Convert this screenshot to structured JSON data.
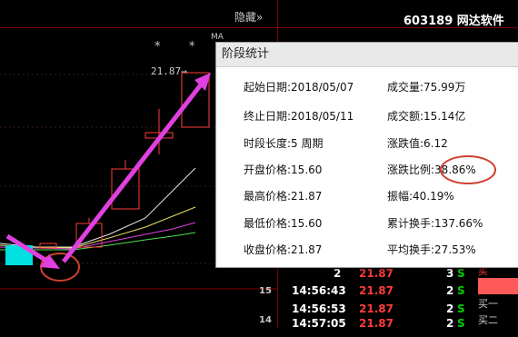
{
  "header": {
    "hide_label": "隐藏»",
    "stock_code_name": "603189 网达软件"
  },
  "chart": {
    "ma_label": "MA",
    "stars": [
      "*",
      "*"
    ],
    "price_marker": "21.87→"
  },
  "dialog": {
    "title": "阶段统计",
    "left": [
      {
        "label": "起始日期:",
        "value": "2018/05/07"
      },
      {
        "label": "终止日期:",
        "value": "2018/05/11"
      },
      {
        "label": "时段长度:",
        "value": "5 周期"
      },
      {
        "label": "开盘价格:",
        "value": "15.60"
      },
      {
        "label": "最高价格:",
        "value": "21.87"
      },
      {
        "label": "最低价格:",
        "value": "15.60"
      },
      {
        "label": "收盘价格:",
        "value": "21.87"
      }
    ],
    "right": [
      {
        "label": "成交量:",
        "value": "75.99万"
      },
      {
        "label": "成交额:",
        "value": "15.14亿"
      },
      {
        "label": "涨跌值:",
        "value": "6.12"
      },
      {
        "label": "涨跌比例:",
        "value": "38.86%"
      },
      {
        "label": "振幅:",
        "value": "40.19%"
      },
      {
        "label": "累计换手:",
        "value": "137.66%"
      },
      {
        "label": "平均换手:",
        "value": "27.53%"
      }
    ]
  },
  "ticks": [
    {
      "time": "2",
      "price": "21.87",
      "vol": "3",
      "side": "S"
    },
    {
      "time": "14:56:43",
      "price": "21.87",
      "vol": "2",
      "side": "S"
    },
    {
      "time": "14:56:53",
      "price": "21.87",
      "vol": "2",
      "side": "S"
    },
    {
      "time": "14:57:05",
      "price": "21.87",
      "vol": "2",
      "side": "S"
    }
  ],
  "row_numbers": [
    "15",
    "14"
  ],
  "side_labels": [
    "买",
    "买一",
    "买二"
  ],
  "colors": {
    "up_candle": "#ff3b3b",
    "arrow": "#e040e0",
    "annotation_circle": "#d04030",
    "sell_green": "#00d000"
  }
}
